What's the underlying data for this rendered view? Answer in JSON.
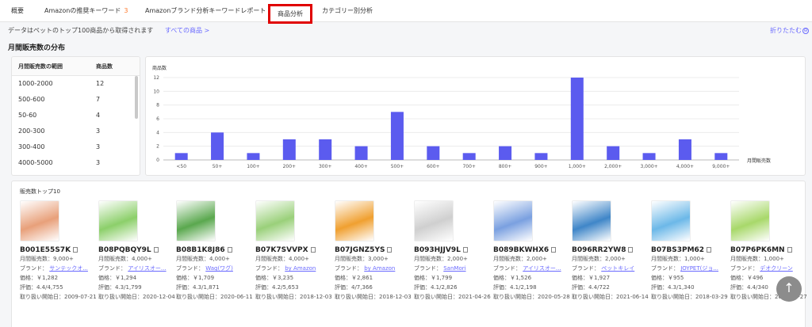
{
  "tabs": [
    {
      "label": "概要"
    },
    {
      "label": "Amazonの推奨キーワード",
      "badge": "3"
    },
    {
      "label": "Amazonブランド分析キーワードレポート"
    },
    {
      "label": "商品分析"
    },
    {
      "label": "カテゴリー別分析"
    }
  ],
  "notice": {
    "text": "データはペットのトップ100商品から取得されます",
    "link": "すべての商品 >",
    "collapse": "折りたたむ",
    "collapse_icon": "⊖"
  },
  "section_title": "月間販売数の分布",
  "range_table": {
    "headers": [
      "月間販売数の範囲",
      "商品数"
    ],
    "rows": [
      [
        "1000-2000",
        "12"
      ],
      [
        "500-600",
        "7"
      ],
      [
        "50-60",
        "4"
      ],
      [
        "200-300",
        "3"
      ],
      [
        "300-400",
        "3"
      ],
      [
        "4000-5000",
        "3"
      ],
      [
        "400-500",
        "2"
      ]
    ]
  },
  "chart_data": {
    "type": "bar",
    "ylabel": "商品数",
    "xlabel": "月間販売数",
    "ylim": [
      0,
      12
    ],
    "yticks": [
      0,
      2,
      4,
      6,
      8,
      10,
      12
    ],
    "categories": [
      "<50",
      "50+",
      "100+",
      "200+",
      "300+",
      "400+",
      "500+",
      "600+",
      "700+",
      "800+",
      "900+",
      "1,000+",
      "2,000+",
      "3,000+",
      "4,000+",
      "9,000+"
    ],
    "values": [
      1,
      4,
      1,
      3,
      3,
      2,
      7,
      2,
      1,
      2,
      1,
      12,
      2,
      1,
      3,
      1
    ],
    "bar_color": "#5b5bef",
    "grid": "horizontal"
  },
  "products": {
    "title": "販売数トップ10",
    "labels": {
      "monthly": "月間販売数：",
      "brand": "ブランド：",
      "price": "価格：",
      "rating": "評価：",
      "start": "取り扱い開始日："
    },
    "items": [
      {
        "asin": "B001E55S7K",
        "monthly": "9,000+",
        "brand": "サンテックオ...",
        "price": "￥1,282",
        "rating": "4.4/4,755",
        "start": "2009-07-21",
        "color": "#e8a07a"
      },
      {
        "asin": "B08PQBQY9L",
        "monthly": "4,000+",
        "brand": "アイリスオー...",
        "price": "￥1,294",
        "rating": "4.3/1,799",
        "start": "2020-12-04",
        "color": "#8ccf6a"
      },
      {
        "asin": "B08B1K8J86",
        "monthly": "4,000+",
        "brand": "Wag(ワグ)",
        "price": "￥1,709",
        "rating": "4.3/1,871",
        "start": "2020-06-11",
        "color": "#5aa84e"
      },
      {
        "asin": "B07K7SVVPX",
        "monthly": "4,000+",
        "brand": "by Amazon",
        "price": "￥3,235",
        "rating": "4.2/5,653",
        "start": "2018-12-03",
        "color": "#9ad07a"
      },
      {
        "asin": "B07JGNZ5YS",
        "monthly": "3,000+",
        "brand": "by Amazon",
        "price": "￥2,861",
        "rating": "4/7,366",
        "start": "2018-12-03",
        "color": "#f0a030"
      },
      {
        "asin": "B093HJJV9L",
        "monthly": "2,000+",
        "brand": "SanMori",
        "price": "￥1,799",
        "rating": "4.1/2,826",
        "start": "2021-04-26",
        "color": "#cfcfcf"
      },
      {
        "asin": "B089BKWHX6",
        "monthly": "2,000+",
        "brand": "アイリスオー...",
        "price": "￥1,526",
        "rating": "4.1/2,198",
        "start": "2020-05-28",
        "color": "#7aa0e0"
      },
      {
        "asin": "B096RR2YW8",
        "monthly": "2,000+",
        "brand": "ペットキレイ",
        "price": "￥1,927",
        "rating": "4.4/722",
        "start": "2021-06-14",
        "color": "#3f86c8"
      },
      {
        "asin": "B07BS3PM62",
        "monthly": "1,000+",
        "brand": "JOYPET(ジョ...",
        "price": "￥955",
        "rating": "4.3/1,340",
        "start": "2018-03-29",
        "color": "#6cb8e8"
      },
      {
        "asin": "B07P6PK6MN",
        "monthly": "1,000+",
        "brand": "デオクリーン",
        "price": "￥496",
        "rating": "4.4/340",
        "start": "2019-02-27",
        "color": "#a8d86a"
      }
    ]
  },
  "scroll_top_icon": "↑"
}
